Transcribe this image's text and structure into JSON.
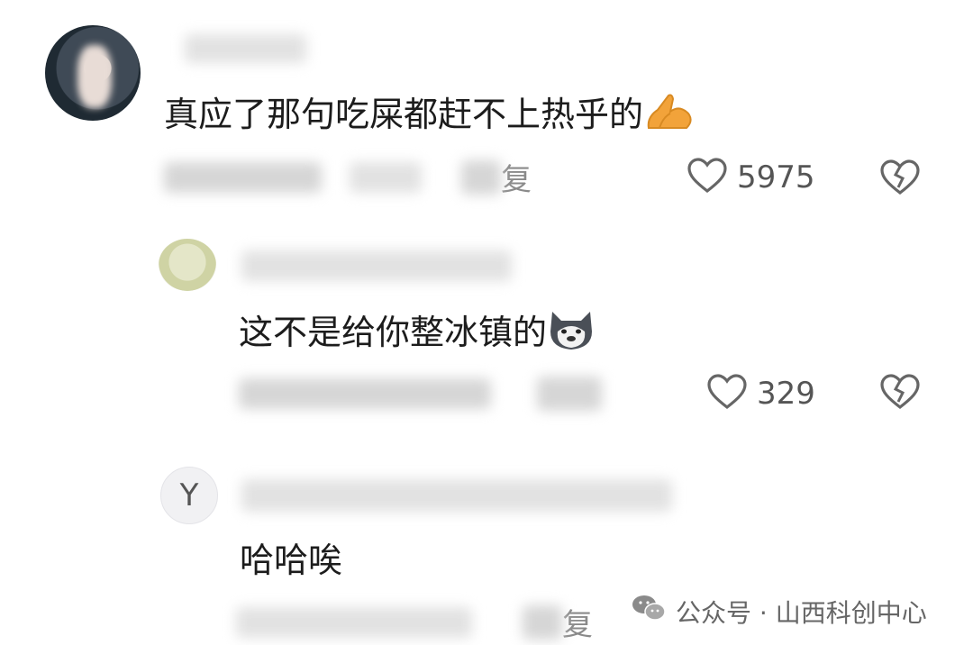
{
  "comments": [
    {
      "text": "真应了那句吃屎都赶不上热乎的",
      "emoji": "praying-hands",
      "reply_label": "复",
      "likes": "5975"
    },
    {
      "text": "这不是给你整冰镇的",
      "emoji": "husky-dog",
      "likes": "329"
    },
    {
      "avatar_letter": "Y",
      "text": "哈哈唉",
      "reply_label": "复"
    }
  ],
  "watermark": {
    "icon": "wechat-icon",
    "text": "公众号 · 山西科创中心"
  },
  "colors": {
    "heart": "#666666",
    "emoji_hands": "#f2a33a",
    "text": "#1c1c1c",
    "meta": "#9a9a9a"
  }
}
